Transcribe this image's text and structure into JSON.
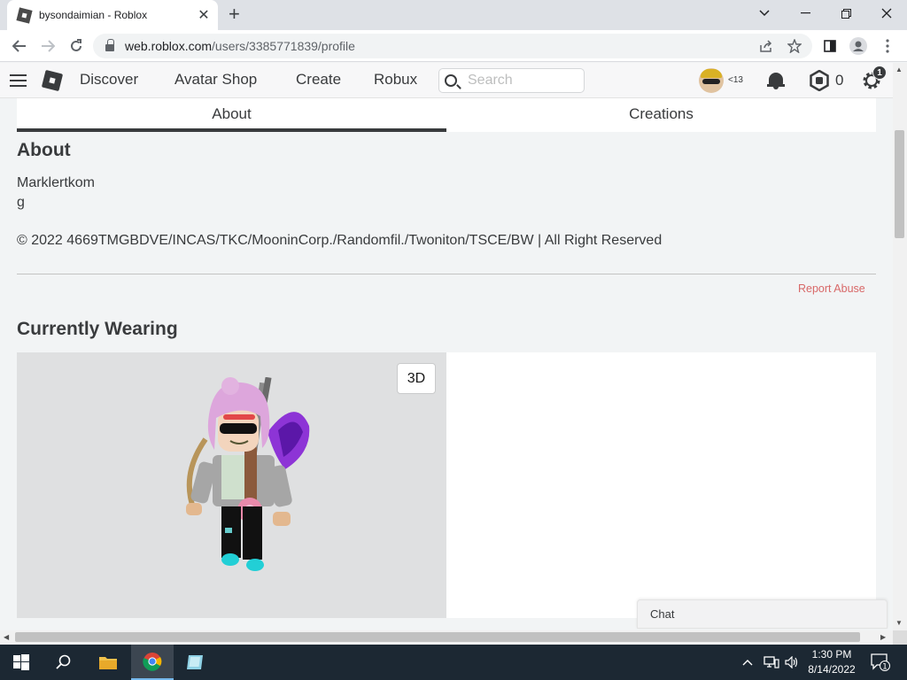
{
  "browser": {
    "tab_title": "bysondaimian - Roblox",
    "tab_close": "✕",
    "new_tab": "+",
    "url_host": "web.roblox.com",
    "url_path": "/users/3385771839/profile"
  },
  "header": {
    "nav": [
      "Discover",
      "Avatar Shop",
      "Create",
      "Robux"
    ],
    "search_placeholder": "Search",
    "age_label": "<13",
    "robux_count": "0",
    "settings_badge": "1"
  },
  "profile_tabs": [
    "About",
    "Creations"
  ],
  "active_tab": "About",
  "about": {
    "heading": "About",
    "description": "Marklertkom\ng",
    "copyright": "© 2022 4669TMGBDVE/INCAS/TKC/MooninCorp./Randomfil./Twoniton/TSCE/BW | All Right Reserved",
    "report_link": "Report Abuse"
  },
  "wearing": {
    "heading": "Currently Wearing",
    "view_toggle": "3D"
  },
  "chat": {
    "label": "Chat"
  },
  "taskbar": {
    "time": "1:30 PM",
    "date": "8/14/2022",
    "notification_count": "1"
  },
  "colors": {
    "page_bg": "#f2f4f5",
    "text": "#393b3d",
    "report_link": "#d86868",
    "taskbar": "#1c2833"
  }
}
